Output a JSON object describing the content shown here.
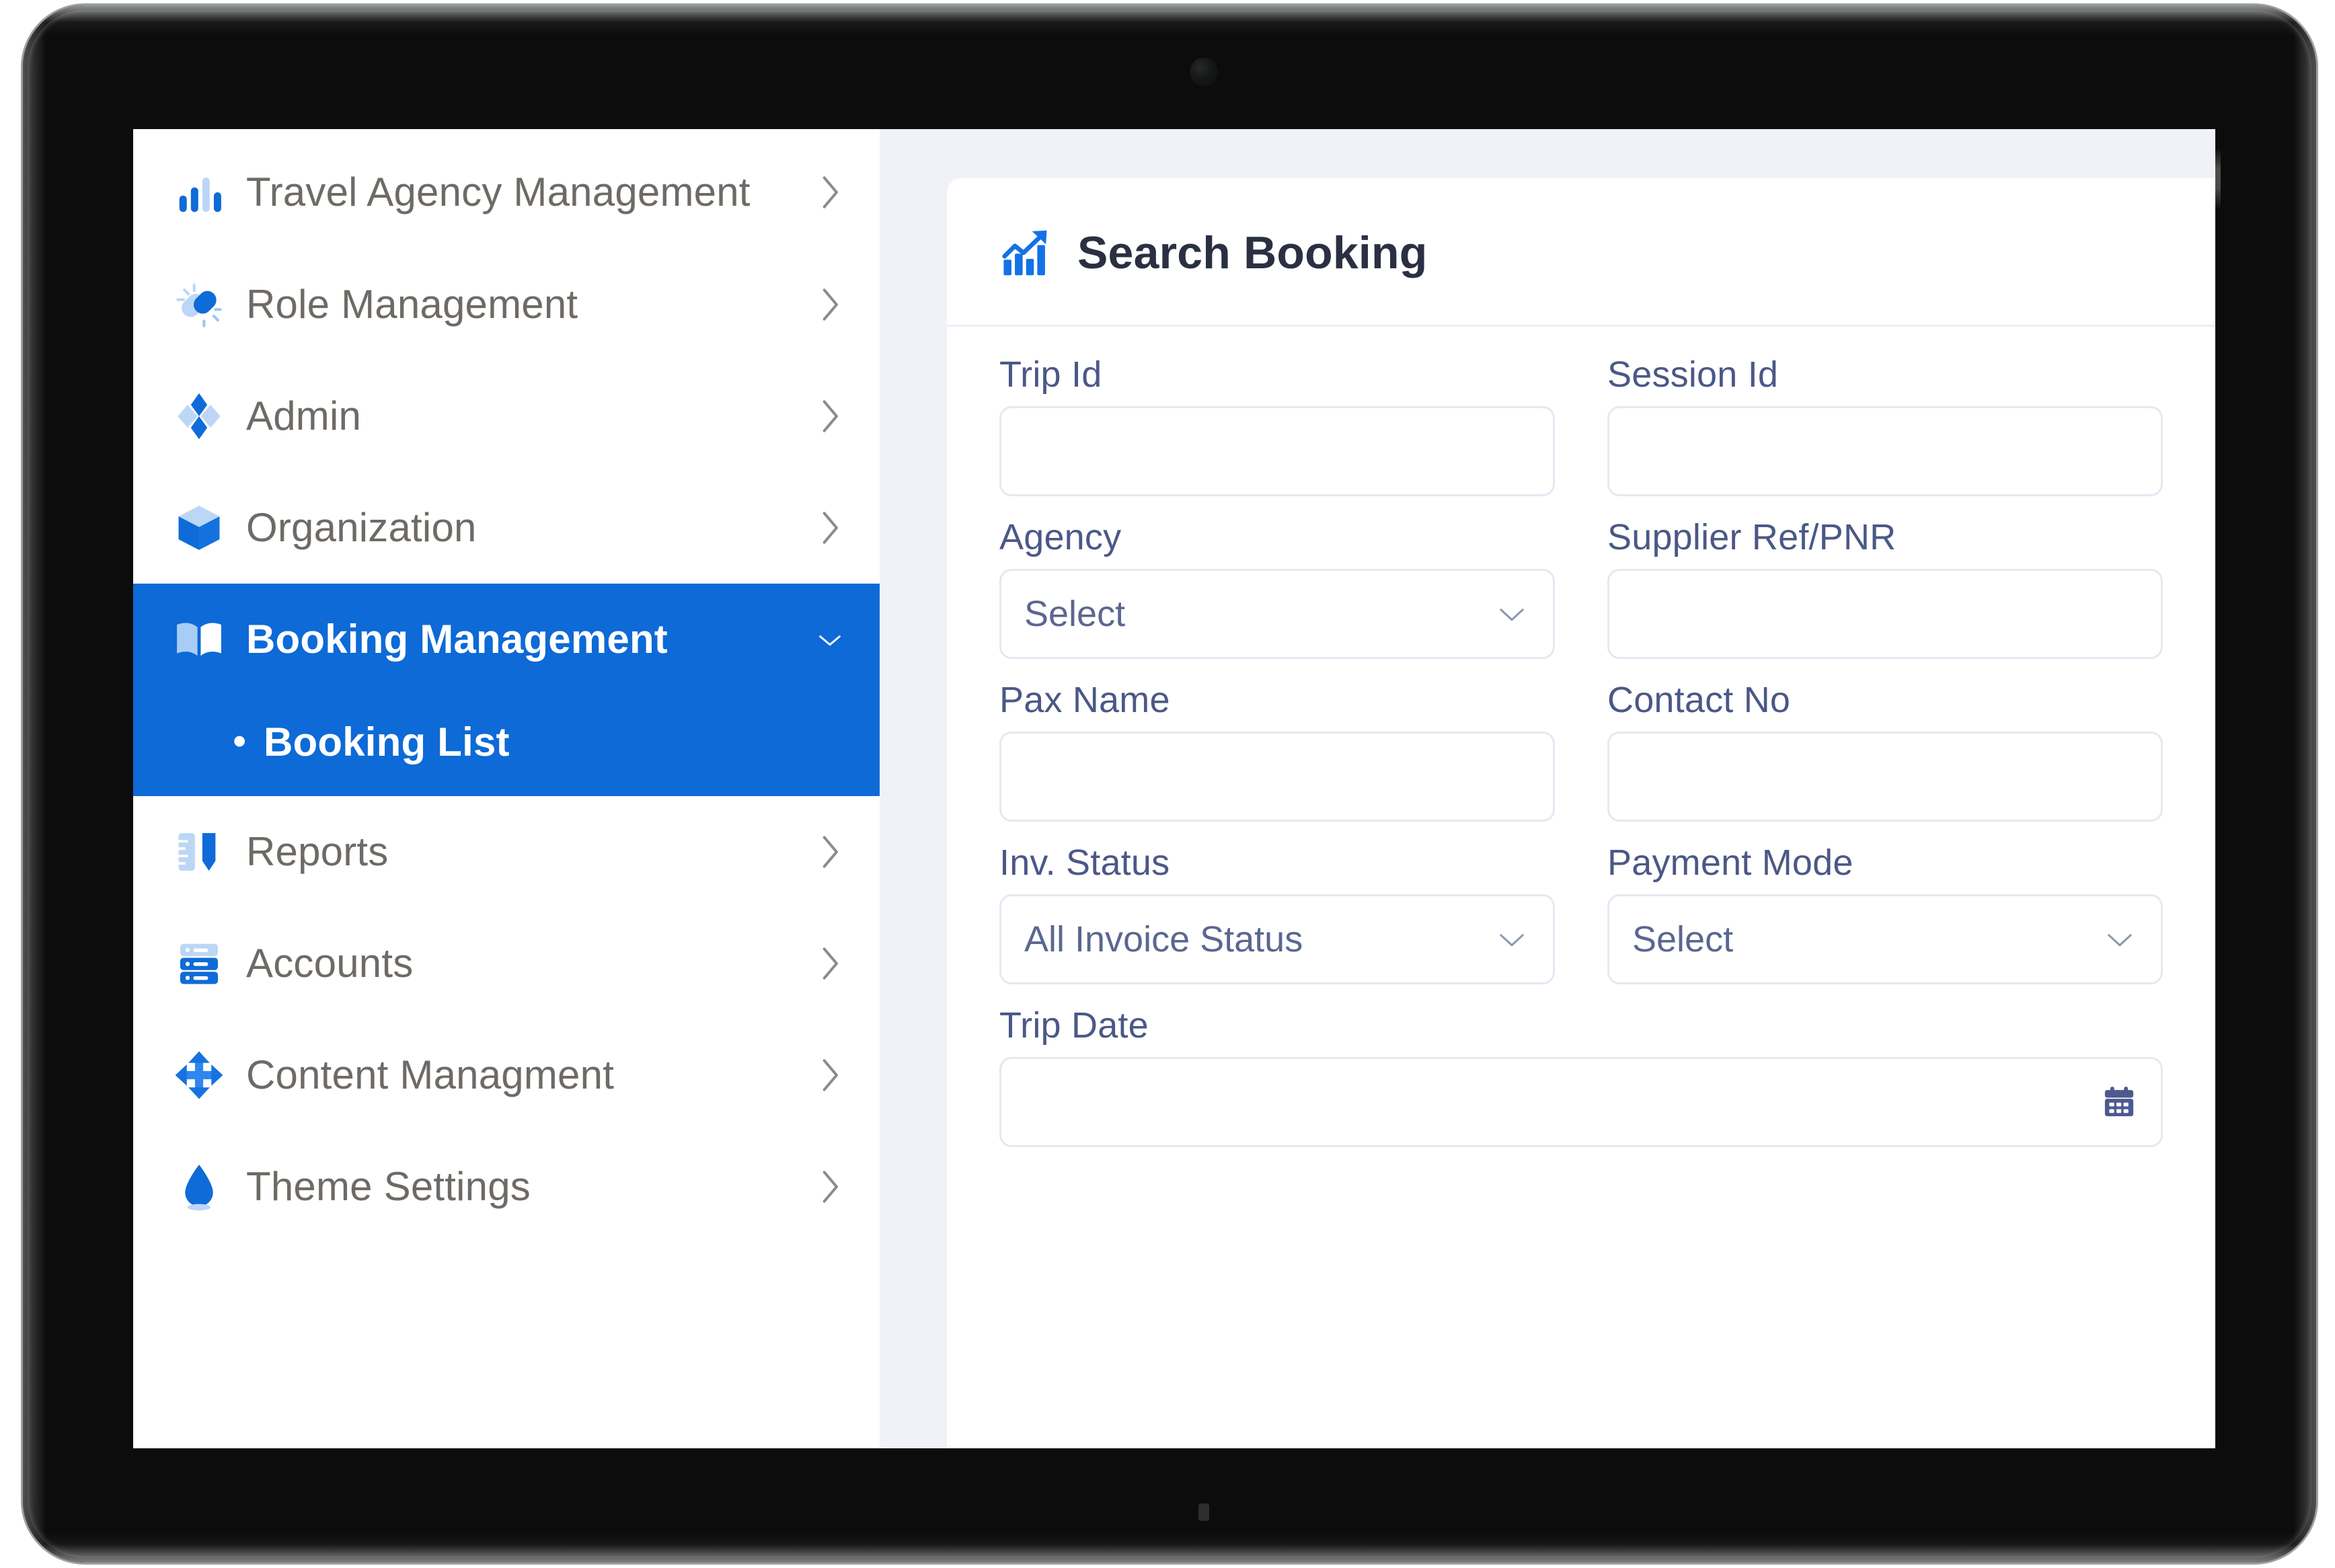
{
  "device": {
    "kind": "tablet"
  },
  "sidebar": {
    "items": [
      {
        "label": "Travel Agency Management",
        "icon": "bar-chart-icon",
        "chevron": "chevron-right-icon",
        "active": false
      },
      {
        "label": "Role Management",
        "icon": "magic-link-icon",
        "chevron": "chevron-right-icon",
        "active": false
      },
      {
        "label": "Admin",
        "icon": "diamonds-icon",
        "chevron": "chevron-right-icon",
        "active": false
      },
      {
        "label": "Organization",
        "icon": "cube-box-icon",
        "chevron": "chevron-right-icon",
        "active": false
      },
      {
        "label": "Booking Management",
        "icon": "open-book-icon",
        "chevron": "chevron-down-icon",
        "active": true
      },
      {
        "label": "Reports",
        "icon": "ruler-pen-icon",
        "chevron": "chevron-right-icon",
        "active": false
      },
      {
        "label": "Accounts",
        "icon": "server-stack-icon",
        "chevron": "chevron-right-icon",
        "active": false
      },
      {
        "label": "Content Managment",
        "icon": "move-arrows-icon",
        "chevron": "chevron-right-icon",
        "active": false
      },
      {
        "label": "Theme Settings",
        "icon": "water-drop-icon",
        "chevron": "chevron-right-icon",
        "active": false
      }
    ],
    "submenu": {
      "parent": "Booking Management",
      "bullet": "•",
      "items": [
        {
          "label": "Booking List",
          "active": true
        }
      ]
    },
    "active_bg_color": "#0d6ad6",
    "label_color": "#6e6a66"
  },
  "main": {
    "card": {
      "title": "Search Booking",
      "title_icon": "growth-chart-icon"
    },
    "form": {
      "rows": [
        {
          "fields": [
            {
              "label": "Trip Id",
              "type": "text",
              "value": "",
              "placeholder": ""
            },
            {
              "label": "Session Id",
              "type": "text",
              "value": "",
              "placeholder": ""
            }
          ]
        },
        {
          "fields": [
            {
              "label": "Agency",
              "type": "select",
              "value": "Select",
              "placeholder": ""
            },
            {
              "label": "Supplier Ref/PNR",
              "type": "text",
              "value": "",
              "placeholder": ""
            }
          ]
        },
        {
          "fields": [
            {
              "label": "Pax Name",
              "type": "text",
              "value": "",
              "placeholder": ""
            },
            {
              "label": "Contact No",
              "type": "text",
              "value": "",
              "placeholder": ""
            }
          ]
        },
        {
          "fields": [
            {
              "label": "Inv. Status",
              "type": "select",
              "value": "All Invoice Status",
              "placeholder": ""
            },
            {
              "label": "Payment Mode",
              "type": "select",
              "value": "Select",
              "placeholder": ""
            }
          ]
        },
        {
          "fields": [
            {
              "label": "Trip Date",
              "type": "date",
              "value": "",
              "placeholder": "",
              "icon": "calendar-icon"
            }
          ]
        }
      ]
    }
  },
  "colors": {
    "accent_blue": "#0d6ad6",
    "icon_blue_dark": "#0f6bd8",
    "icon_blue_light": "#bcd7f6",
    "label_blue": "#4b5887",
    "field_border": "#e6e8f2",
    "page_bg": "#f1f2f7",
    "title_color": "#2a3042"
  }
}
